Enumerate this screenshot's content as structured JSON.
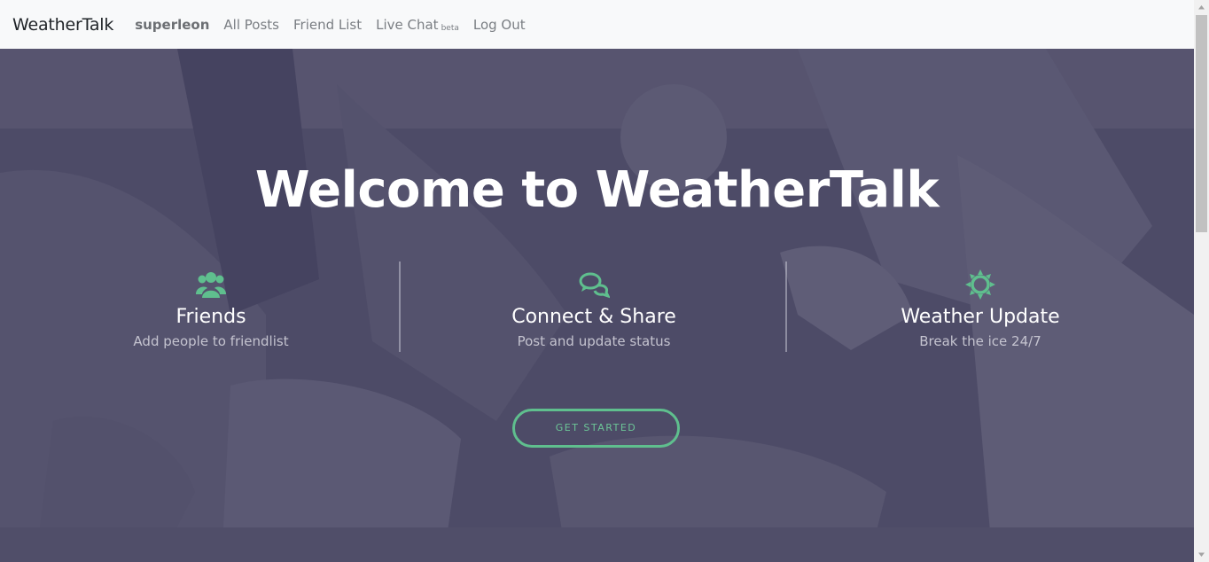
{
  "nav": {
    "brand": "WeatherTalk",
    "user": "superleon",
    "all_posts": "All Posts",
    "friend_list": "Friend List",
    "live_chat": "Live Chat",
    "live_chat_badge": "beta",
    "log_out": "Log Out"
  },
  "hero": {
    "headline": "Welcome to WeatherTalk",
    "features": [
      {
        "icon": "users-icon",
        "title": "Friends",
        "subtitle": "Add people to friendlist"
      },
      {
        "icon": "chat-bubbles-icon",
        "title": "Connect & Share",
        "subtitle": "Post and update status"
      },
      {
        "icon": "sun-icon",
        "title": "Weather Update",
        "subtitle": "Break the ice 24/7"
      }
    ],
    "cta_label": "GET STARTED"
  },
  "colors": {
    "accent": "#5fbf8e",
    "overlay": "#4c4a66",
    "navbar_bg": "#f8f9fa"
  }
}
